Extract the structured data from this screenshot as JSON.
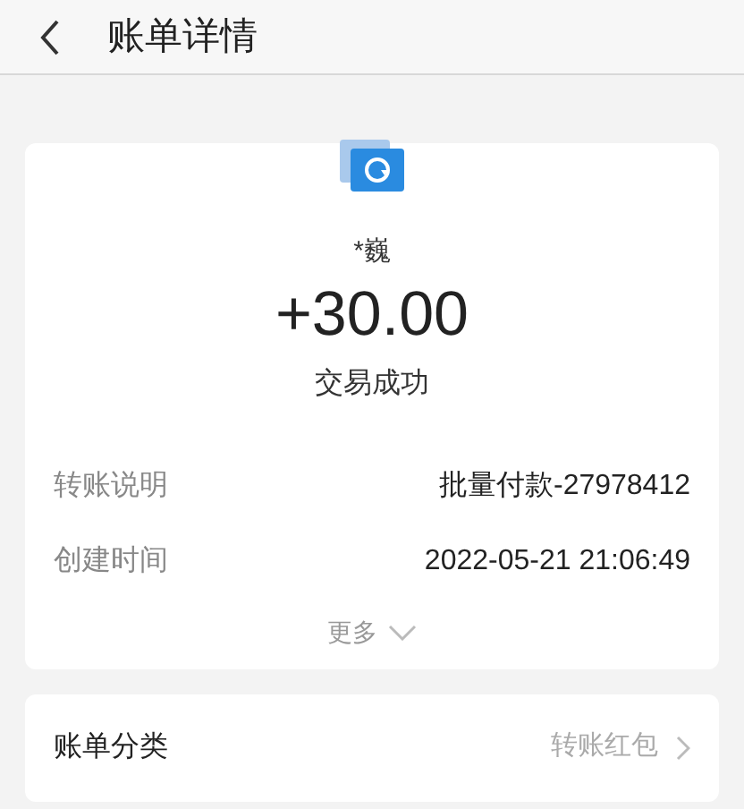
{
  "header": {
    "title": "账单详情"
  },
  "summary": {
    "payer": "*巍",
    "amount": "+30.00",
    "status": "交易成功"
  },
  "details": [
    {
      "label": "转账说明",
      "value": "批量付款-27978412"
    },
    {
      "label": "创建时间",
      "value": "2022-05-21 21:06:49"
    }
  ],
  "more": "更多",
  "category": {
    "label": "账单分类",
    "value": "转账红包"
  }
}
